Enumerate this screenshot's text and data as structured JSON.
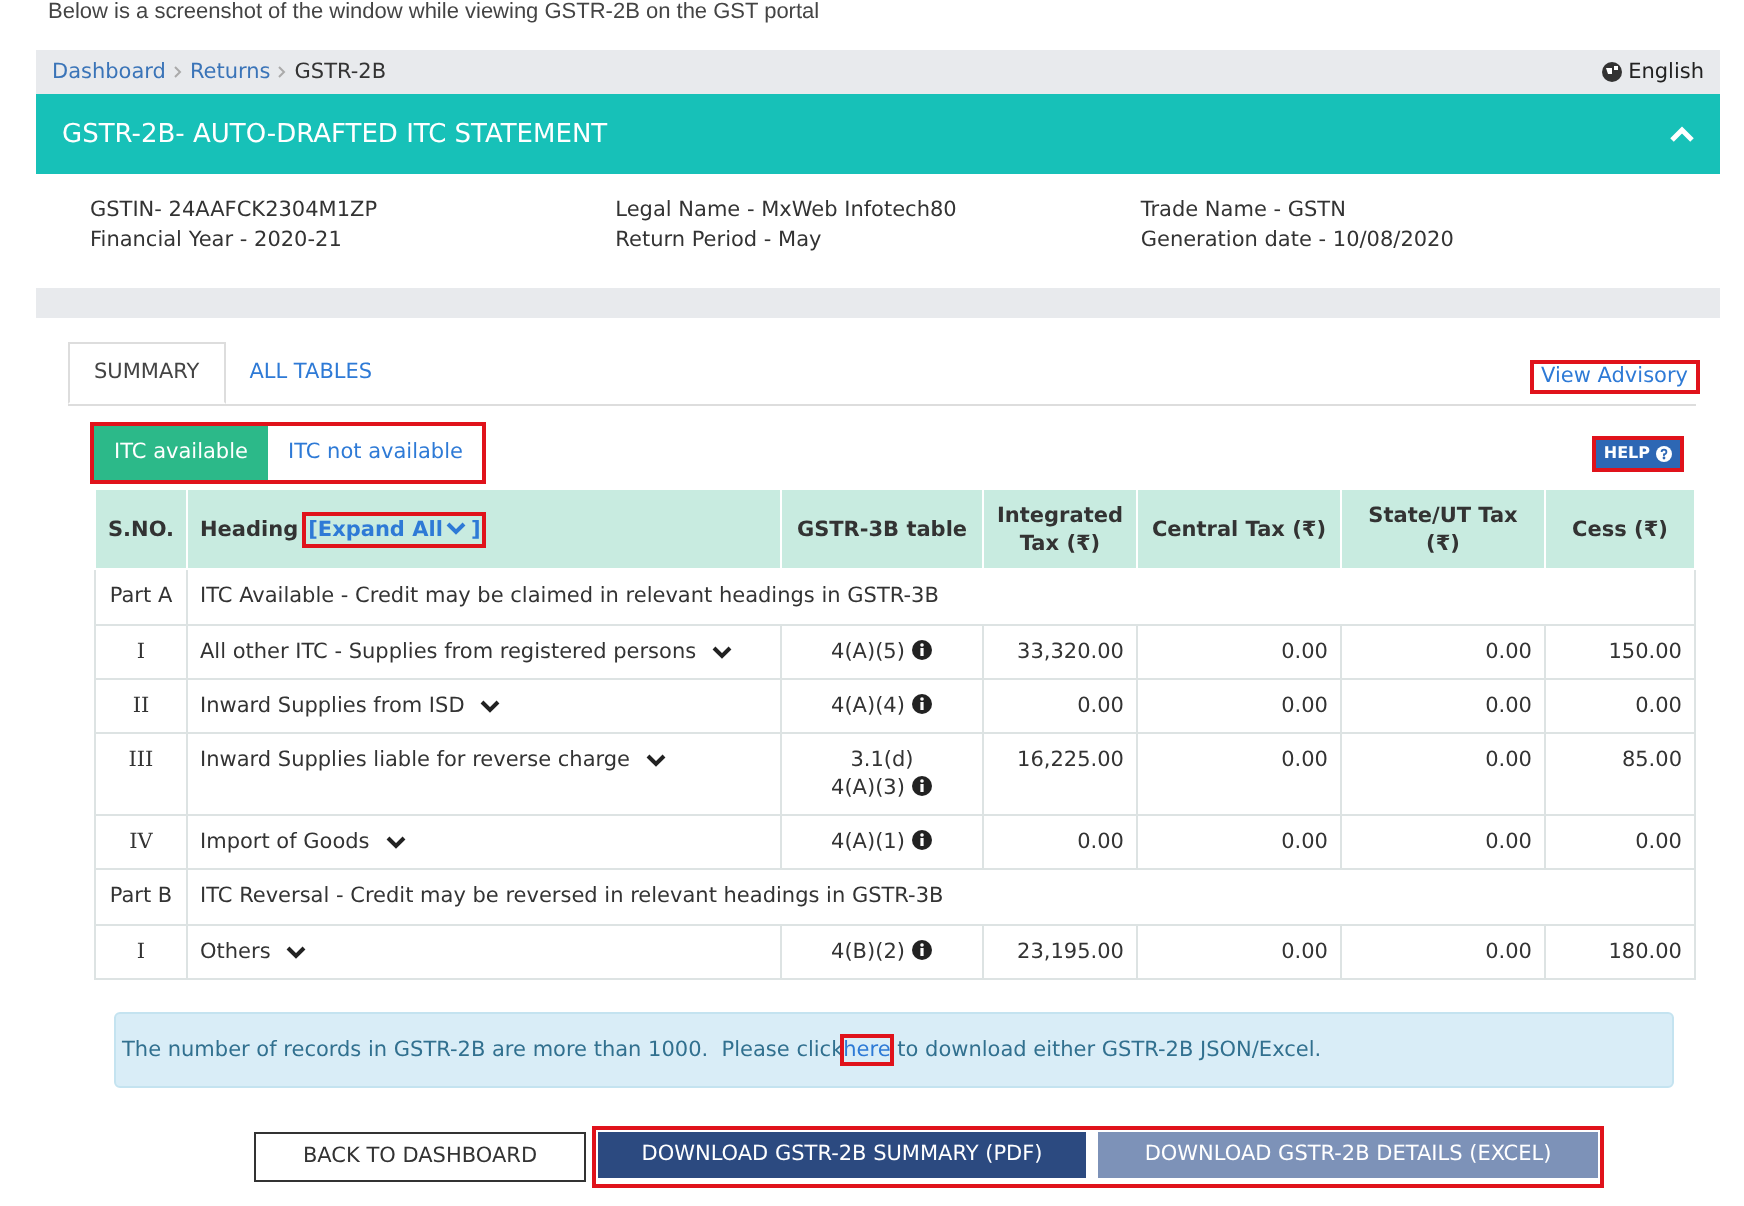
{
  "caption": "Below is a screenshot of the window while viewing GSTR-2B on the GST portal",
  "breadcrumb": [
    {
      "label": "Dashboard",
      "kind": "link"
    },
    {
      "label": "Returns",
      "kind": "link"
    },
    {
      "label": "GSTR-2B",
      "kind": "current"
    }
  ],
  "language": "English",
  "panel": {
    "title": "GSTR-2B- AUTO-DRAFTED ITC STATEMENT",
    "expanded": true
  },
  "info": [
    [
      "GSTIN- 24AAFCK2304M1ZP",
      "Financial Year - 2020-21"
    ],
    [
      "Legal Name - MxWeb Infotech80",
      "Return Period - May"
    ],
    [
      "Trade Name - GSTN",
      "Generation date - 10/08/2020"
    ]
  ],
  "tabs": [
    {
      "label": "SUMMARY",
      "selected": true
    },
    {
      "label": "ALL TABLES",
      "selected": false
    }
  ],
  "advisory_link": {
    "label": "View Advisory",
    "highlighted": true
  },
  "toggle": {
    "highlighted": true,
    "options": [
      {
        "label": "ITC available",
        "selected": true
      },
      {
        "label": "ITC not available",
        "selected": false
      }
    ]
  },
  "help_button": {
    "label": "HELP",
    "highlighted": true
  },
  "table": {
    "columns": [
      "S.NO.",
      "Heading",
      "GSTR-3B table",
      "Integrated Tax (₹)",
      "Central Tax (₹)",
      "State/UT Tax (₹)",
      "Cess (₹)"
    ],
    "expand_all": {
      "label": "[Expand All",
      "suffix": "]",
      "highlighted": true
    },
    "rows": [
      {
        "kind": "part",
        "sno": "Part A",
        "text": "ITC Available - Credit may be claimed in relevant headings in GSTR-3B"
      },
      {
        "kind": "item",
        "sno": "I",
        "heading": "All other ITC - Supplies from registered persons",
        "refs": [
          "4(A)(5)"
        ],
        "values": [
          "33,320.00",
          "0.00",
          "0.00",
          "150.00"
        ]
      },
      {
        "kind": "item",
        "sno": "II",
        "heading": "Inward Supplies from ISD",
        "refs": [
          "4(A)(4)"
        ],
        "values": [
          "0.00",
          "0.00",
          "0.00",
          "0.00"
        ]
      },
      {
        "kind": "item",
        "sno": "III",
        "heading": "Inward Supplies liable for reverse charge",
        "refs": [
          "3.1(d)",
          "4(A)(3)"
        ],
        "values": [
          "16,225.00",
          "0.00",
          "0.00",
          "85.00"
        ]
      },
      {
        "kind": "item",
        "sno": "IV",
        "heading": "Import of Goods",
        "refs": [
          "4(A)(1)"
        ],
        "values": [
          "0.00",
          "0.00",
          "0.00",
          "0.00"
        ]
      },
      {
        "kind": "part",
        "sno": "Part B",
        "text": "ITC Reversal - Credit may be reversed in relevant headings in GSTR-3B"
      },
      {
        "kind": "item",
        "sno": "I",
        "heading": "Others",
        "refs": [
          "4(B)(2)"
        ],
        "values": [
          "23,195.00",
          "0.00",
          "0.00",
          "180.00"
        ]
      }
    ]
  },
  "notice": {
    "before": "The number of records in GSTR-2B are more than 1000.  Please click",
    "link": "here",
    "after": "to download either GSTR-2B JSON/Excel.",
    "link_highlighted": true
  },
  "buttons": [
    {
      "label": "BACK TO DASHBOARD",
      "kind": "outline"
    },
    {
      "label": "DOWNLOAD GSTR-2B SUMMARY (PDF)",
      "kind": "primary"
    },
    {
      "label": "DOWNLOAD GSTR-2B DETAILS (EXCEL)",
      "kind": "secondary"
    }
  ],
  "download_group_highlighted": true
}
